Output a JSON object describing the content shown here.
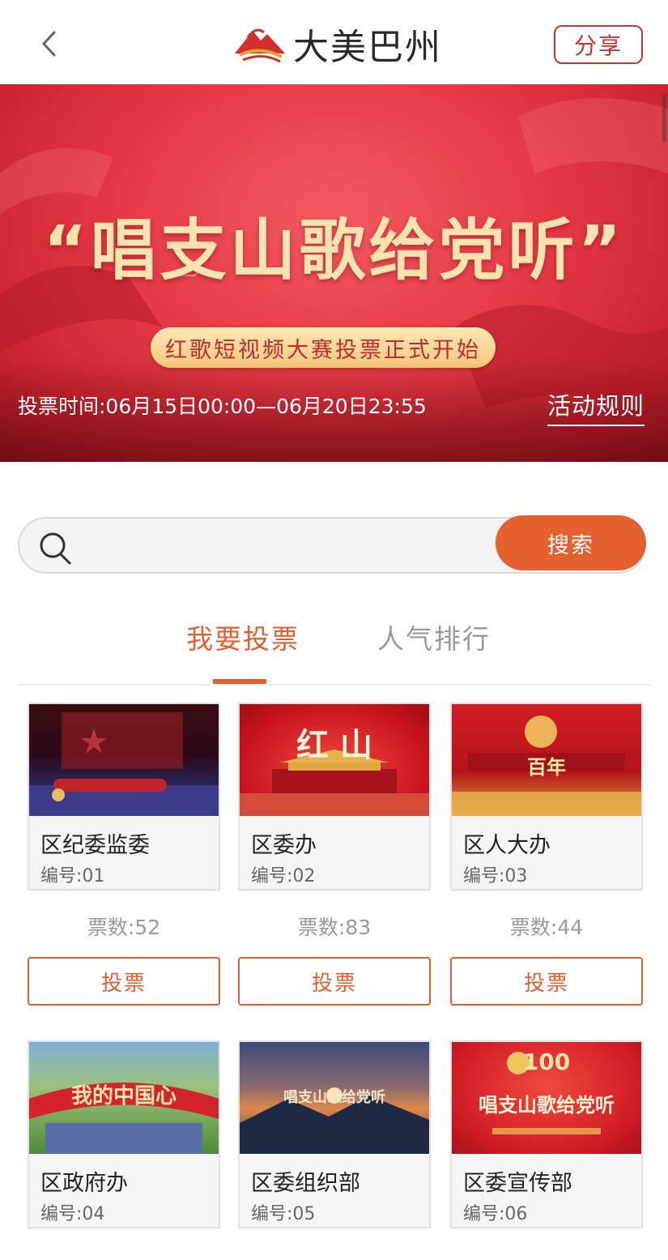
{
  "header": {
    "back_icon": "chevron-left-icon",
    "brand_name": "大美巴州",
    "share_label": "分享"
  },
  "banner": {
    "title": "“唱支山歌给党听”",
    "subtitle": "红歌短视频大赛投票正式开始",
    "vote_time": "投票时间:06月15日00:00—06月20日23:55",
    "rules_label": "活动规则"
  },
  "search": {
    "placeholder": "",
    "button_label": "搜索"
  },
  "tabs": [
    {
      "label": "我要投票",
      "active": true
    },
    {
      "label": "人气排行",
      "active": false
    }
  ],
  "entries": [
    {
      "name": "区纪委监委",
      "number": "编号:01",
      "votes": "票数:52",
      "button": "投票",
      "thumb_text": "",
      "thumb_sub": ""
    },
    {
      "name": "区委办",
      "number": "编号:02",
      "votes": "票数:83",
      "button": "投票",
      "thumb_text": "红 山",
      "thumb_sub": ""
    },
    {
      "name": "区人大办",
      "number": "编号:03",
      "votes": "票数:44",
      "button": "投票",
      "thumb_text": "百年",
      "thumb_sub": ""
    },
    {
      "name": "区政府办",
      "number": "编号:04",
      "thumb_text": "我的中国心",
      "thumb_sub": ""
    },
    {
      "name": "区委组织部",
      "number": "编号:05",
      "thumb_text": "唱支山歌给党听",
      "thumb_sub": ""
    },
    {
      "name": "区委宣传部",
      "number": "编号:06",
      "thumb_text": "唱支山歌给党听",
      "thumb_sub": "100"
    }
  ],
  "colors": {
    "accent": "#e0602f",
    "brand_red": "#c8352d",
    "banner_red": "#e63a46",
    "banner_gold": "#fbe3b0"
  }
}
